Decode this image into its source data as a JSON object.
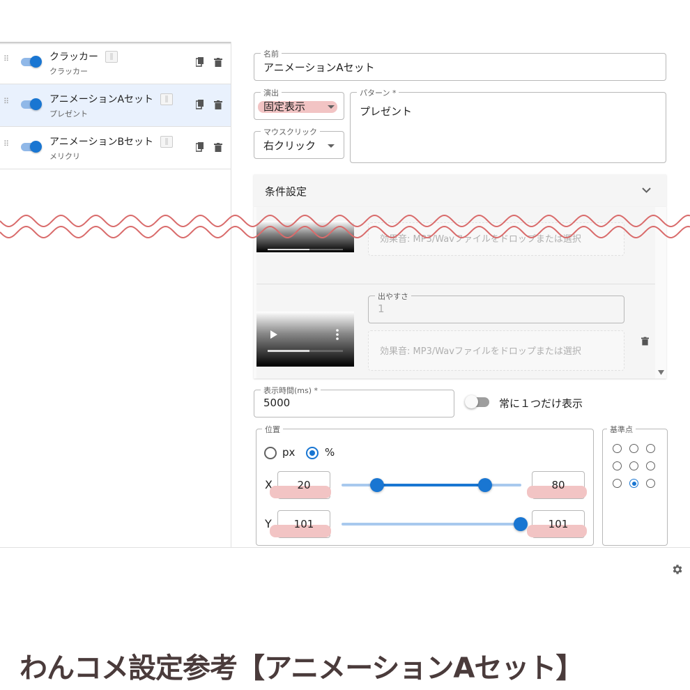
{
  "sidebar": {
    "items": [
      {
        "title": "クラッカー",
        "subtitle": "クラッカー",
        "enabled": true,
        "selected": false
      },
      {
        "title": "アニメーションAセット",
        "subtitle": "プレゼント",
        "enabled": true,
        "selected": true
      },
      {
        "title": "アニメーションBセット",
        "subtitle": "メリクリ",
        "enabled": true,
        "selected": false
      }
    ]
  },
  "form": {
    "name": {
      "label": "名前",
      "value": "アニメーションAセット"
    },
    "effect": {
      "label": "演出",
      "value": "固定表示"
    },
    "mouse_click": {
      "label": "マウスクリック",
      "value": "右クリック"
    },
    "pattern": {
      "label": "パターン *",
      "value": "プレゼント"
    },
    "conditions": {
      "label": "条件設定"
    },
    "sound_placeholder": "効果音: MP3/Wavファイルをドロップまたは選択",
    "ease": {
      "label": "出やすさ",
      "value": "1"
    },
    "display_time": {
      "label": "表示時間(ms) *",
      "value": "5000"
    },
    "only_one": {
      "label": "常に１つだけ表示",
      "enabled": false
    },
    "position": {
      "label": "位置",
      "unit_px": "px",
      "unit_pct": "%",
      "selected_unit": "%",
      "x_label": "X",
      "x_min": "20",
      "x_max": "80",
      "y_label": "Y",
      "y_min": "101",
      "y_max": "101"
    },
    "anchor": {
      "label": "基準点",
      "selected": "bottom-center"
    }
  },
  "footer_title": "わんコメ設定参考【アニメーションAセット】",
  "colors": {
    "accent": "#1976d2",
    "highlight": "#f2c4c4",
    "wave": "#d96b6b",
    "title": "#4a3b3b"
  }
}
